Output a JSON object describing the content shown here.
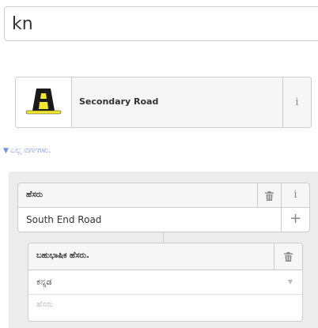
{
  "search": {
    "value": "kn"
  },
  "preset": {
    "label": "Secondary Road",
    "icon": "secondary-road-icon",
    "info_glyph": "i",
    "colors": {
      "road": "#1a1a1a",
      "stripe": "#f1e82a"
    }
  },
  "all_fields": {
    "label": "ಎಲ್ಲ ವರ್ಗಗಳು."
  },
  "name_field": {
    "label": "ಹೆಸರು",
    "value": "South End Road",
    "info_glyph": "i",
    "add_glyph": "+",
    "trash_icon": "trash-icon"
  },
  "multilingual": {
    "label": "ಬಹುಭಾಷಿಕ ಹೆಸರು.",
    "language": "ಕನ್ನಡ",
    "name_placeholder": "ಹೆಸರು",
    "trash_icon": "trash-icon"
  },
  "colors": {
    "link": "#6f8df2",
    "border": "#cccccc",
    "section_bg": "#ececec",
    "label_bg": "#f6f6f6"
  }
}
